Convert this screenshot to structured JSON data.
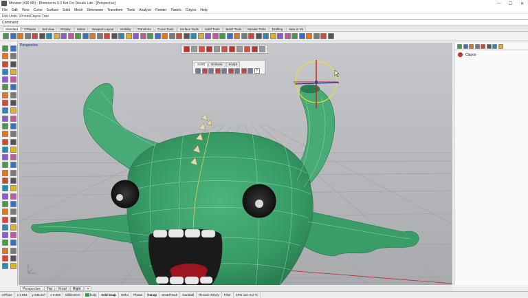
{
  "window": {
    "title": "Monster (436 KB) - Rhinoceros 5.0 Not For Resale Lab - [Perspective]",
    "buttons": [
      "—",
      "☐",
      "✕"
    ]
  },
  "menu": [
    "File",
    "Edit",
    "View",
    "Curve",
    "Surface",
    "Solid",
    "Mesh",
    "Dimension",
    "Transform",
    "Tools",
    "Analyze",
    "Render",
    "Panels",
    "Clayoo",
    "Help"
  ],
  "command": {
    "history": "Unit Units: 10 mm/Clayoo Tree",
    "prompt": "Command:"
  },
  "toolbar_tabs": [
    "Standard",
    "CPlanes",
    "Set View",
    "Display",
    "Select",
    "Viewport Layout",
    "Visibility",
    "Transform",
    "Curve Tools",
    "Surface Tools",
    "Solid Tools",
    "Mesh Tools",
    "Render Tools",
    "Drafting",
    "New in V5"
  ],
  "viewport": {
    "label": "Perspective"
  },
  "subd_panel": {
    "tabs": [
      "SubD",
      "Emboss",
      "Sculpt"
    ],
    "help": "?"
  },
  "side_panel": {
    "layer_name": "Clayoo"
  },
  "viewport_tabs": [
    "Perspective",
    "Top",
    "Front",
    "Right",
    "+"
  ],
  "status": {
    "cplane": "CPlane",
    "x": "x 4.894",
    "y": "y 236.247",
    "z": "z 0.000",
    "units": "Millimeters",
    "layer": "body",
    "grid_snap": "Grid Snap",
    "ortho": "Ortho",
    "planar": "Planar",
    "osnap": "Osnap",
    "smarttrack": "SmartTrack",
    "gumball": "Gumball",
    "record_history": "Record History",
    "filter": "Filter",
    "cpu": "CPU use: 8.2 %"
  },
  "colors": {
    "viewport_bg": "#b8b9bd",
    "monster_green": "#3c9f6a",
    "horn_green": "#48ab76",
    "mouth_red": "#9e1420",
    "gumball_yellow": "#e8e030",
    "selection_blue": "#2040a0"
  }
}
